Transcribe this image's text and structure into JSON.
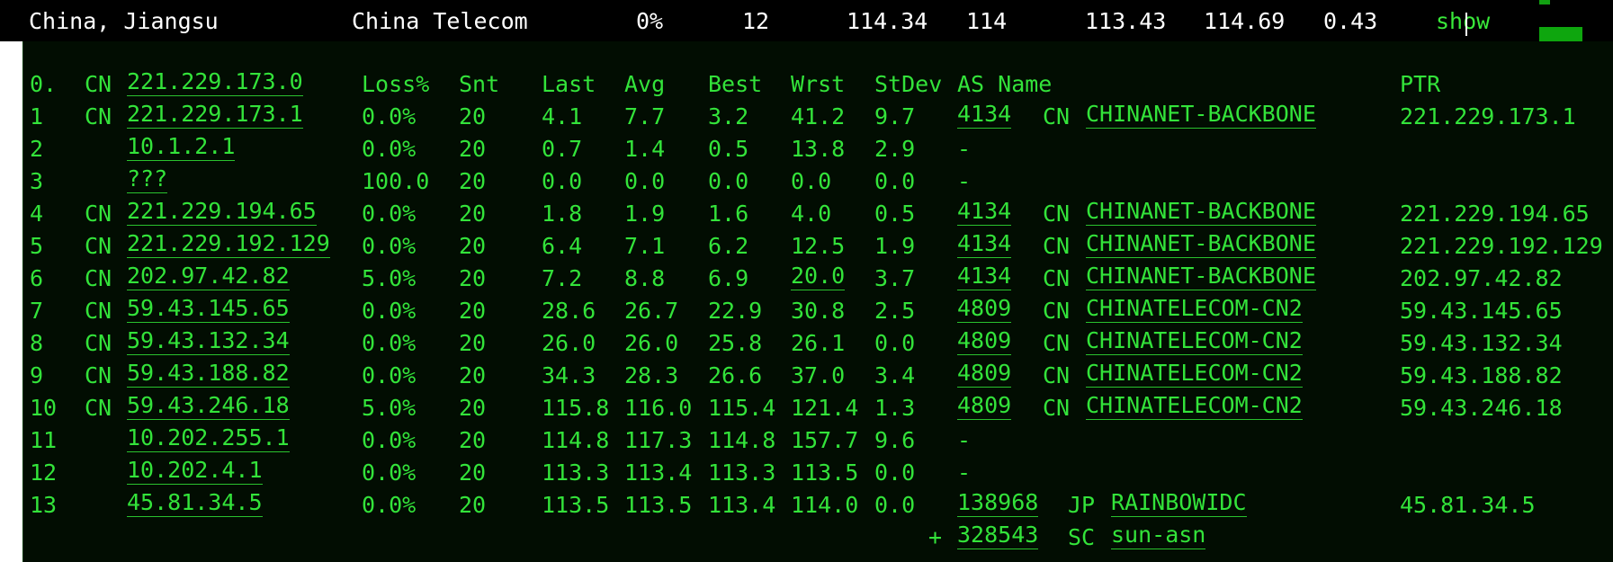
{
  "summary": {
    "location": "China, Jiangsu",
    "isp": "China Telecom",
    "loss": "0%",
    "sent": "12",
    "last": "114.34",
    "avg_int": "114",
    "best": "113.43",
    "worst": "114.69",
    "stdev": "0.43",
    "action": "show"
  },
  "headers": {
    "hop": "0.",
    "cc": "CN",
    "host": "221.229.173.0",
    "loss": "Loss%",
    "snt": "Snt",
    "last": "Last",
    "avg": "Avg",
    "best": "Best",
    "wrst": "Wrst",
    "stdev": "StDev",
    "asname": "AS Name",
    "ptr": "PTR"
  },
  "hops": [
    {
      "hop": "1",
      "cc": "CN",
      "host": "221.229.173.1",
      "loss": "0.0%",
      "snt": "20",
      "last": "4.1",
      "avg": "7.7",
      "best": "3.2",
      "wrst": "41.2",
      "stdev": "9.7",
      "asn": "4134",
      "as_cc": "CN",
      "as_name": "CHINANET-BACKBONE",
      "ptr": "221.229.173.1"
    },
    {
      "hop": "2",
      "cc": "",
      "host": "10.1.2.1",
      "loss": "0.0%",
      "snt": "20",
      "last": "0.7",
      "avg": "1.4",
      "best": "0.5",
      "wrst": "13.8",
      "stdev": "2.9",
      "asn": "-",
      "as_cc": "",
      "as_name": "",
      "ptr": ""
    },
    {
      "hop": "3",
      "cc": "",
      "host": "???",
      "loss": "100.0",
      "snt": "20",
      "last": "0.0",
      "avg": "0.0",
      "best": "0.0",
      "wrst": "0.0",
      "stdev": "0.0",
      "asn": "-",
      "as_cc": "",
      "as_name": "",
      "ptr": ""
    },
    {
      "hop": "4",
      "cc": "CN",
      "host": "221.229.194.65",
      "loss": "0.0%",
      "snt": "20",
      "last": "1.8",
      "avg": "1.9",
      "best": "1.6",
      "wrst": "4.0",
      "stdev": "0.5",
      "asn": "4134",
      "as_cc": "CN",
      "as_name": "CHINANET-BACKBONE",
      "ptr": "221.229.194.65"
    },
    {
      "hop": "5",
      "cc": "CN",
      "host": "221.229.192.129",
      "loss": "0.0%",
      "snt": "20",
      "last": "6.4",
      "avg": "7.1",
      "best": "6.2",
      "wrst": "12.5",
      "stdev": "1.9",
      "asn": "4134",
      "as_cc": "CN",
      "as_name": "CHINANET-BACKBONE",
      "ptr": "221.229.192.129"
    },
    {
      "hop": "6",
      "cc": "CN",
      "host": "202.97.42.82",
      "loss": "5.0%",
      "snt": "20",
      "last": "7.2",
      "avg": "8.8",
      "best": "6.9",
      "wrst": "20.0",
      "stdev": "3.7",
      "asn": "4134",
      "as_cc": "CN",
      "as_name": "CHINANET-BACKBONE",
      "ptr": "202.97.42.82"
    },
    {
      "hop": "7",
      "cc": "CN",
      "host": "59.43.145.65",
      "loss": "0.0%",
      "snt": "20",
      "last": "28.6",
      "avg": "26.7",
      "best": "22.9",
      "wrst": "30.8",
      "stdev": "2.5",
      "asn": "4809",
      "as_cc": "CN",
      "as_name": "CHINATELECOM-CN2",
      "ptr": "59.43.145.65"
    },
    {
      "hop": "8",
      "cc": "CN",
      "host": "59.43.132.34",
      "loss": "0.0%",
      "snt": "20",
      "last": "26.0",
      "avg": "26.0",
      "best": "25.8",
      "wrst": "26.1",
      "stdev": "0.0",
      "asn": "4809",
      "as_cc": "CN",
      "as_name": "CHINATELECOM-CN2",
      "ptr": "59.43.132.34"
    },
    {
      "hop": "9",
      "cc": "CN",
      "host": "59.43.188.82",
      "loss": "0.0%",
      "snt": "20",
      "last": "34.3",
      "avg": "28.3",
      "best": "26.6",
      "wrst": "37.0",
      "stdev": "3.4",
      "asn": "4809",
      "as_cc": "CN",
      "as_name": "CHINATELECOM-CN2",
      "ptr": "59.43.188.82"
    },
    {
      "hop": "10",
      "cc": "CN",
      "host": "59.43.246.18",
      "loss": "5.0%",
      "snt": "20",
      "last": "115.8",
      "avg": "116.0",
      "best": "115.4",
      "wrst": "121.4",
      "stdev": "1.3",
      "asn": "4809",
      "as_cc": "CN",
      "as_name": "CHINATELECOM-CN2",
      "ptr": "59.43.246.18"
    },
    {
      "hop": "11",
      "cc": "",
      "host": "10.202.255.1",
      "loss": "0.0%",
      "snt": "20",
      "last": "114.8",
      "avg": "117.3",
      "best": "114.8",
      "wrst": "157.7",
      "stdev": "9.6",
      "asn": "-",
      "as_cc": "",
      "as_name": "",
      "ptr": ""
    },
    {
      "hop": "12",
      "cc": "",
      "host": "10.202.4.1",
      "loss": "0.0%",
      "snt": "20",
      "last": "113.3",
      "avg": "113.4",
      "best": "113.3",
      "wrst": "113.5",
      "stdev": "0.0",
      "asn": "-",
      "as_cc": "",
      "as_name": "",
      "ptr": ""
    },
    {
      "hop": "13",
      "cc": "",
      "host": "45.81.34.5",
      "loss": "0.0%",
      "snt": "20",
      "last": "113.5",
      "avg": "113.5",
      "best": "113.4",
      "wrst": "114.0",
      "stdev": "0.0",
      "asn": "138968",
      "as_cc": "JP",
      "as_name": "RAINBOWIDC",
      "ptr": "45.81.34.5"
    }
  ],
  "extra_as": {
    "prefix": "+",
    "asn": "328543",
    "as_cc": "SC",
    "as_name": "sun-asn"
  }
}
